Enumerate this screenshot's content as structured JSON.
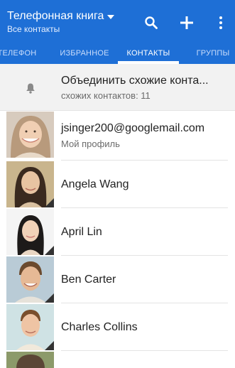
{
  "header": {
    "title": "Телефонная книга",
    "subtitle": "Все контакты",
    "actions": [
      {
        "icon": "search-icon"
      },
      {
        "icon": "plus-icon"
      },
      {
        "icon": "more-vert-icon"
      }
    ]
  },
  "tabs": [
    {
      "label": "ТЕЛЕФОН",
      "active": false
    },
    {
      "label": "ИЗБРАННОЕ",
      "active": false
    },
    {
      "label": "КОНТАКТЫ",
      "active": true
    },
    {
      "label": "ГРУППЫ",
      "active": false
    }
  ],
  "merge": {
    "title": "Объединить схожие конта...",
    "subtitle": "схожих контактов: 11",
    "icon": "bell-icon"
  },
  "profile": {
    "name": "jsinger200@googlemail.com",
    "subtitle": "Мой профиль"
  },
  "contacts": [
    {
      "name": "Angela Wang"
    },
    {
      "name": "April Lin"
    },
    {
      "name": "Ben Carter"
    },
    {
      "name": "Charles Collins"
    }
  ],
  "colors": {
    "appbar": "#1e6fd6",
    "merge_bg": "#f2f2f2",
    "text_primary": "#222222",
    "text_secondary": "#6b6b6b"
  }
}
